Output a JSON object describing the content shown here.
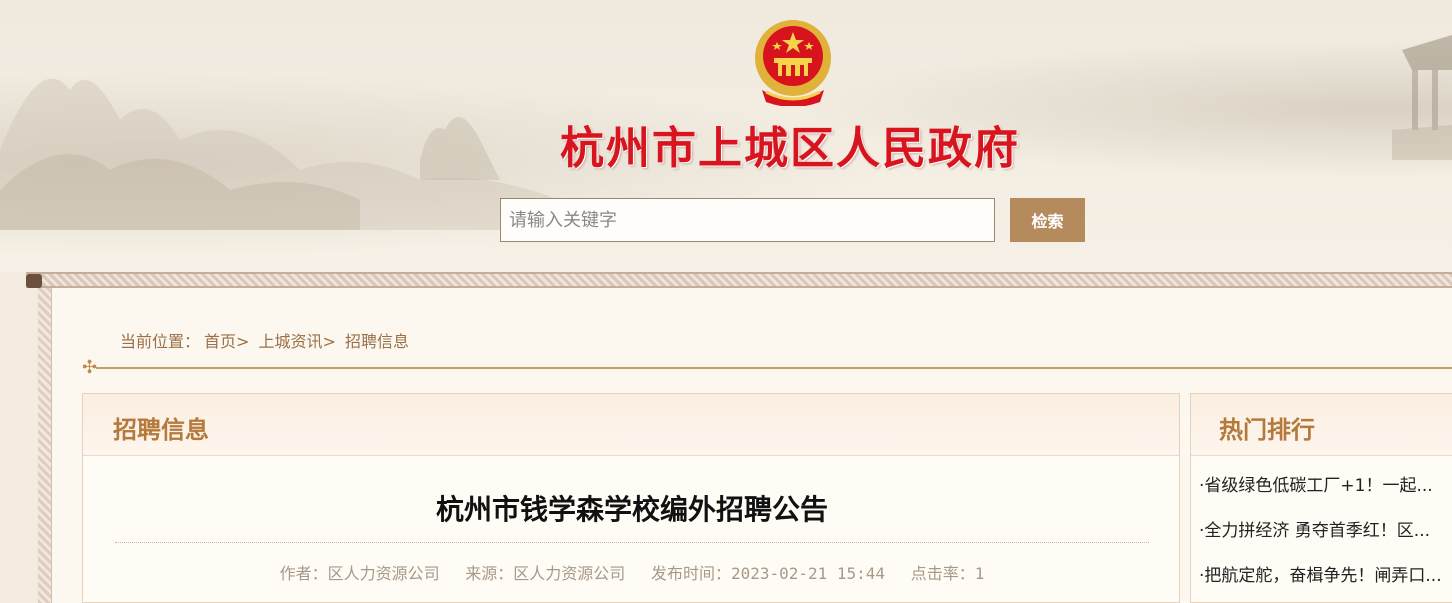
{
  "header": {
    "site_title": "杭州市上城区人民政府",
    "search_placeholder": "请输入关键字",
    "search_button": "检索"
  },
  "breadcrumb": {
    "prefix": "当前位置：",
    "items": [
      "首页>",
      "上城资讯>",
      "招聘信息"
    ]
  },
  "main": {
    "section_title": "招聘信息",
    "article": {
      "title": "杭州市钱学森学校编外招聘公告",
      "author": "作者：区人力资源公司",
      "source": "来源：区人力资源公司",
      "published": "发布时间：2023-02-21 15:44",
      "clicks": "点击率：1"
    }
  },
  "sidebar": {
    "title": "热门排行",
    "items": [
      "·省级绿色低碳工厂+1！一起...",
      "·全力拼经济 勇夺首季红！区...",
      "·把航定舵，奋楫争先！闸弄口..."
    ]
  },
  "colors": {
    "title_red": "#d8141e",
    "accent_brown": "#b58a5c",
    "heading_gold": "#b37a3c"
  }
}
